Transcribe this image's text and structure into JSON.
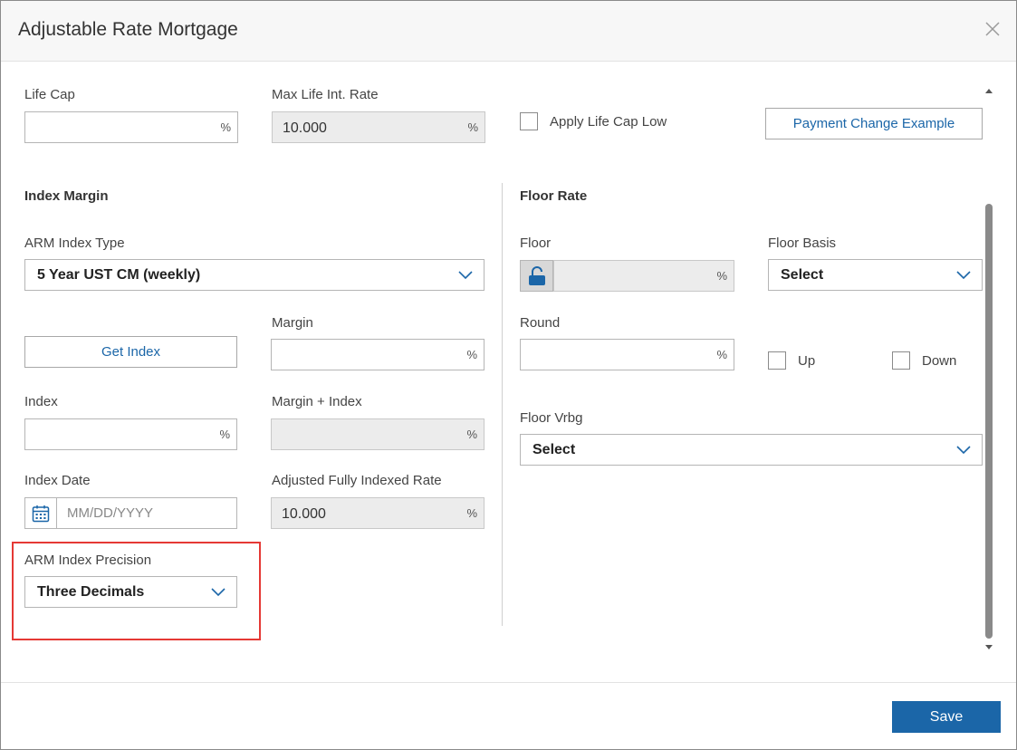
{
  "dialog": {
    "title": "Adjustable Rate Mortgage",
    "close_icon": "close-icon",
    "save_label": "Save"
  },
  "life_cap": {
    "label": "Life Cap",
    "value": "",
    "unit": "%"
  },
  "max_life_rate": {
    "label": "Max Life Int. Rate",
    "value": "10.000",
    "unit": "%"
  },
  "apply_life_cap_low": {
    "label": "Apply Life Cap Low",
    "checked": false
  },
  "payment_change_example": {
    "label": "Payment Change Example"
  },
  "index_margin": {
    "title": "Index Margin",
    "arm_index_type": {
      "label": "ARM Index Type",
      "selected": "5 Year UST CM (weekly)"
    },
    "get_index_label": "Get Index",
    "margin": {
      "label": "Margin",
      "value": "",
      "unit": "%"
    },
    "index": {
      "label": "Index",
      "value": "",
      "unit": "%"
    },
    "margin_plus_index": {
      "label": "Margin + Index",
      "value": "",
      "unit": "%"
    },
    "index_date": {
      "label": "Index Date",
      "placeholder": "MM/DD/YYYY",
      "icon": "calendar-icon"
    },
    "adjusted_rate": {
      "label": "Adjusted Fully Indexed Rate",
      "value": "10.000",
      "unit": "%"
    },
    "arm_index_precision": {
      "label": "ARM Index Precision",
      "selected": "Three Decimals"
    }
  },
  "floor_rate": {
    "title": "Floor Rate",
    "floor": {
      "label": "Floor",
      "value": "",
      "unit": "%",
      "icon": "unlock-icon"
    },
    "floor_basis": {
      "label": "Floor Basis",
      "selected": "Select"
    },
    "round": {
      "label": "Round",
      "value": "",
      "unit": "%"
    },
    "up": {
      "label": "Up",
      "checked": false
    },
    "down": {
      "label": "Down",
      "checked": false
    },
    "floor_vrbg": {
      "label": "Floor Vrbg",
      "selected": "Select"
    }
  },
  "colors": {
    "accent": "#1b66a8",
    "highlight": "#e53935",
    "readonly_bg": "#ececec"
  }
}
